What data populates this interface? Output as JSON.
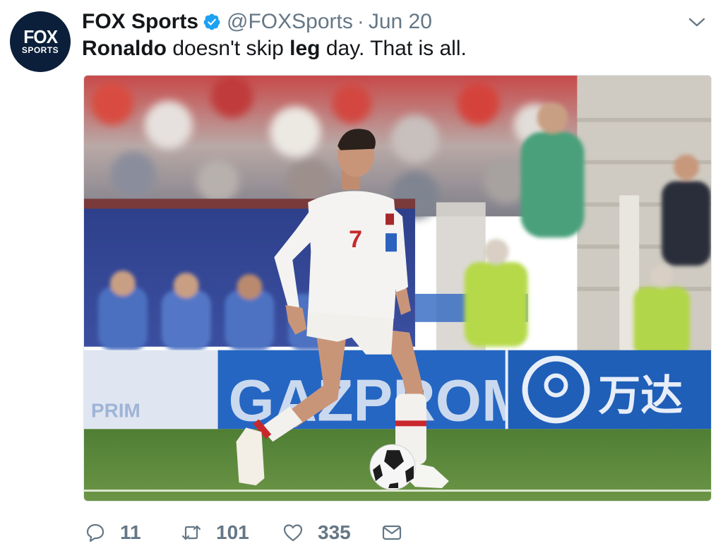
{
  "author": {
    "avatar_line1": "FOX",
    "avatar_line2": "SPORTS",
    "display_name": "FOX Sports",
    "handle": "@FOXSports",
    "separator": "·",
    "date": "Jun 20",
    "verified": true
  },
  "tweet": {
    "text_part1": "Ronaldo",
    "text_part2": " doesn't skip ",
    "text_part3": "leg",
    "text_part4": " day. That is all."
  },
  "media": {
    "ad_board_text": "GAZPROM",
    "ad_board_left_text": "PRIM",
    "ad_board_sponsor_text": "万达",
    "jersey_number": "7"
  },
  "actions": {
    "reply_count": "11",
    "retweet_count": "101",
    "like_count": "335"
  },
  "colors": {
    "verified_blue": "#1da1f2",
    "muted_text": "#657786",
    "avatar_bg": "#0b1f3a",
    "pitch_green": "#5b8a3c",
    "ad_board_blue": "#1f5fb8"
  }
}
